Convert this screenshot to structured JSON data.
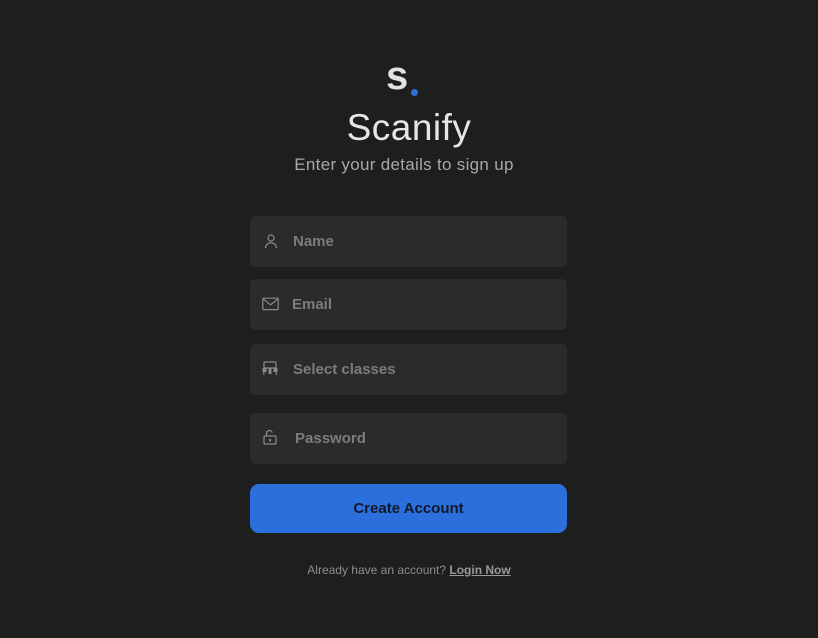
{
  "brand": {
    "logo_letter": "s",
    "name": "Scanify",
    "accent_color": "#2a6fdb"
  },
  "subtitle": "Enter your details to sign up",
  "form": {
    "fields": [
      {
        "icon": "user-icon",
        "placeholder": "Name",
        "value": ""
      },
      {
        "icon": "envelope-icon",
        "placeholder": "Email",
        "value": ""
      },
      {
        "icon": "classroom-icon",
        "placeholder": "Select classes",
        "value": ""
      },
      {
        "icon": "unlock-icon",
        "placeholder": "Password",
        "value": ""
      }
    ],
    "submit_label": "Create Account",
    "submit_color": "#2a6fdb"
  },
  "footer": {
    "prompt": "Already have an account?",
    "link_label": "Login Now"
  }
}
